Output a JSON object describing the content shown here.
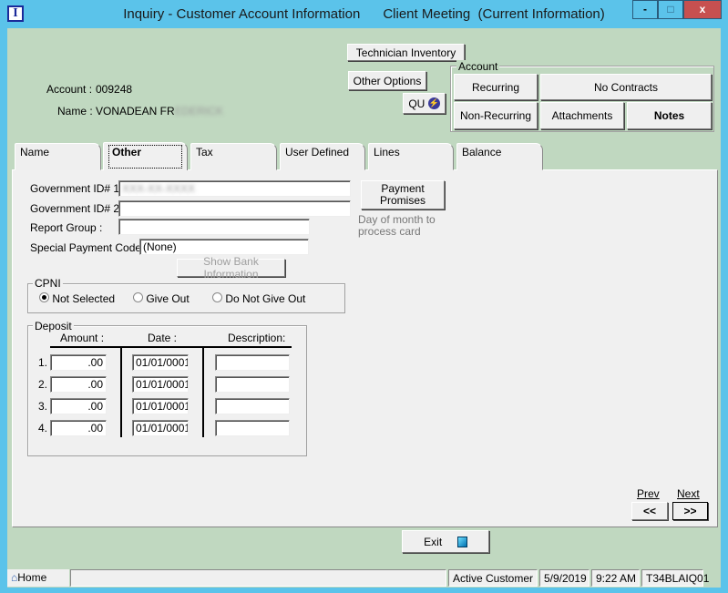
{
  "window": {
    "title": "Inquiry - Customer Account Information",
    "subtitle": "Client Meeting  (Current Information)",
    "icon_letter": "I",
    "minimize": "-",
    "maximize": "□",
    "close": "x"
  },
  "header": {
    "account_label": "Account :",
    "account_value": "009248",
    "name_label": "Name :",
    "name_value": "VONADEAN FR",
    "name_redacted": "EDERICK"
  },
  "buttons": {
    "technician_inventory": "Technician Inventory",
    "other_options": "Other Options",
    "qu": "QU"
  },
  "account_group": {
    "legend": "Account",
    "recurring": "Recurring",
    "no_contracts": "No Contracts",
    "non_recurring": "Non-Recurring",
    "attachments": "Attachments",
    "notes": "Notes"
  },
  "tabs": [
    {
      "label": "Name"
    },
    {
      "label": "Other",
      "active": true
    },
    {
      "label": "Tax"
    },
    {
      "label": "User Defined"
    },
    {
      "label": "Lines"
    },
    {
      "label": "Balance"
    }
  ],
  "form": {
    "gov_id1_label": "Government ID# 1 :",
    "gov_id1_value": "XXX-XX-XXXX",
    "gov_id2_label": "Government ID# 2 :",
    "gov_id2_value": "",
    "report_group_label": "Report Group :",
    "report_group_value": "",
    "special_payment_label": "Special Payment Code :",
    "special_payment_value": "(None)",
    "show_bank": "Show Bank Information",
    "payment_promises": "Payment Promises",
    "day_of_month": "Day of month to process card"
  },
  "cpni": {
    "legend": "CPNI",
    "options": [
      {
        "label": "Not Selected",
        "selected": true
      },
      {
        "label": "Give Out",
        "selected": false
      },
      {
        "label": "Do Not Give Out",
        "selected": false
      }
    ]
  },
  "deposit": {
    "legend": "Deposit",
    "headers": {
      "amount": "Amount :",
      "date": "Date :",
      "description": "Description:"
    },
    "rows": [
      {
        "num": "1.",
        "amount": ".00",
        "date": "01/01/0001",
        "description": ""
      },
      {
        "num": "2.",
        "amount": ".00",
        "date": "01/01/0001",
        "description": ""
      },
      {
        "num": "3.",
        "amount": ".00",
        "date": "01/01/0001",
        "description": ""
      },
      {
        "num": "4.",
        "amount": ".00",
        "date": "01/01/0001",
        "description": ""
      }
    ]
  },
  "nav": {
    "prev_label": "Prev",
    "next_label": "Next",
    "prev_btn": "<<",
    "next_btn": ">>"
  },
  "exit": "Exit",
  "status": {
    "home": "Home",
    "message": "",
    "customer_status": "Active Customer",
    "date": "5/9/2019",
    "time": "9:22 AM",
    "terminal": "T34BLAIQ01"
  },
  "colors": {
    "titlebar": "#5bc3ea",
    "client": "#c0d8c0",
    "panel": "#f0f0f0",
    "close": "#c75050"
  }
}
